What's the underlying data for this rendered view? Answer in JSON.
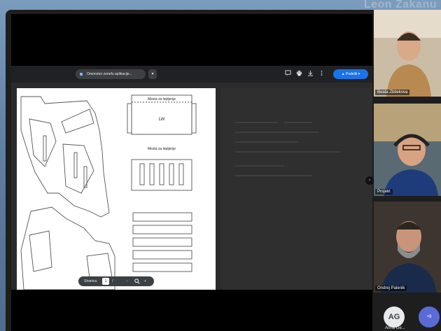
{
  "background": {
    "title": "Leon Zakanu",
    "color": "#6f8fb0"
  },
  "toolbar": {
    "sharing_label": "Onemotor zenefu aplikacije...",
    "chevron": "▾",
    "share_button_label": "▲ Podeliti ▾",
    "icons": [
      "comment-icon",
      "print-icon",
      "download-icon",
      "more-vert-icon"
    ]
  },
  "document": {
    "labels": {
      "top_box_title": "Mesta za lepljenje",
      "top_box_center": "LW",
      "top_box_bottom": "Mesta za lepljenje"
    }
  },
  "page_control": {
    "label": "Stranica",
    "current": "1",
    "separator": "/",
    "zoom_out": "−",
    "zoom_icon": "search-icon",
    "zoom_in": "+"
  },
  "participants": [
    {
      "name": "Beata Zbitekova",
      "color": "#7a6a55"
    },
    {
      "name": "Projekt",
      "color": "#3a4a5a"
    },
    {
      "name": "Ondrej Palenik",
      "color": "#2a2a2a"
    }
  ],
  "participants_overflow": {
    "avatar_initials": "AG",
    "avatar_name": "Anna Ge...",
    "more_label": "+8"
  }
}
